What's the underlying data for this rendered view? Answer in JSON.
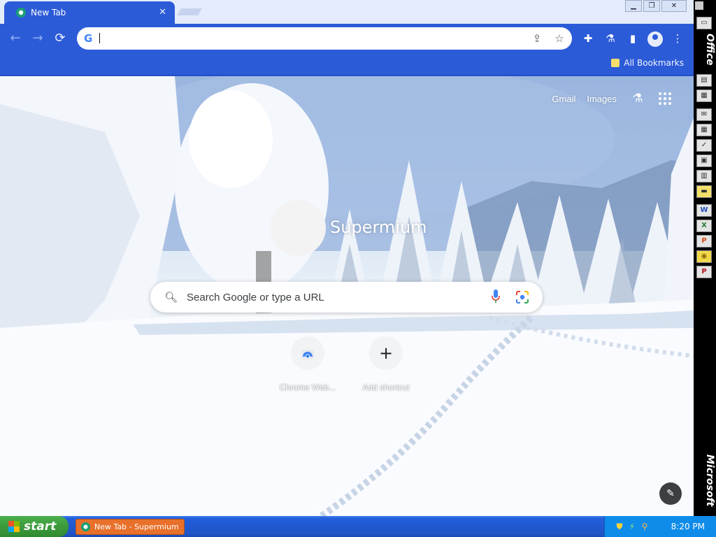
{
  "browser": {
    "tab_title": "New Tab",
    "tab_close": "✕",
    "omnibox_value": "",
    "bookmarks_folder": "All Bookmarks"
  },
  "ntp": {
    "links": [
      "Gmail",
      "Images"
    ],
    "brand": "Supermium",
    "search_placeholder": "Search Google or type a URL",
    "shortcuts": [
      {
        "label": "Chrome Web...",
        "icon": "chrome-web-store-icon"
      },
      {
        "label": "Add shortcut",
        "icon": "plus-icon"
      }
    ]
  },
  "office_bar": {
    "top_label": "Office",
    "bottom_label": "Microsoft",
    "icons": [
      "folder-icon",
      "office-doc-icon",
      "binder-icon",
      "mail-icon",
      "calendar-icon",
      "task-icon",
      "contact-icon",
      "journal-icon",
      "note-icon",
      "word-icon",
      "excel-icon",
      "powerpoint-icon",
      "access-icon",
      "publisher-icon"
    ]
  },
  "taskbar": {
    "start_label": "start",
    "task_label": "New Tab - Supermium",
    "clock": "8:20 PM"
  },
  "colors": {
    "accent": "#2c5bd8",
    "taskbar": "#245edb",
    "start": "#3c9a3c",
    "task_button": "#e8702a"
  }
}
